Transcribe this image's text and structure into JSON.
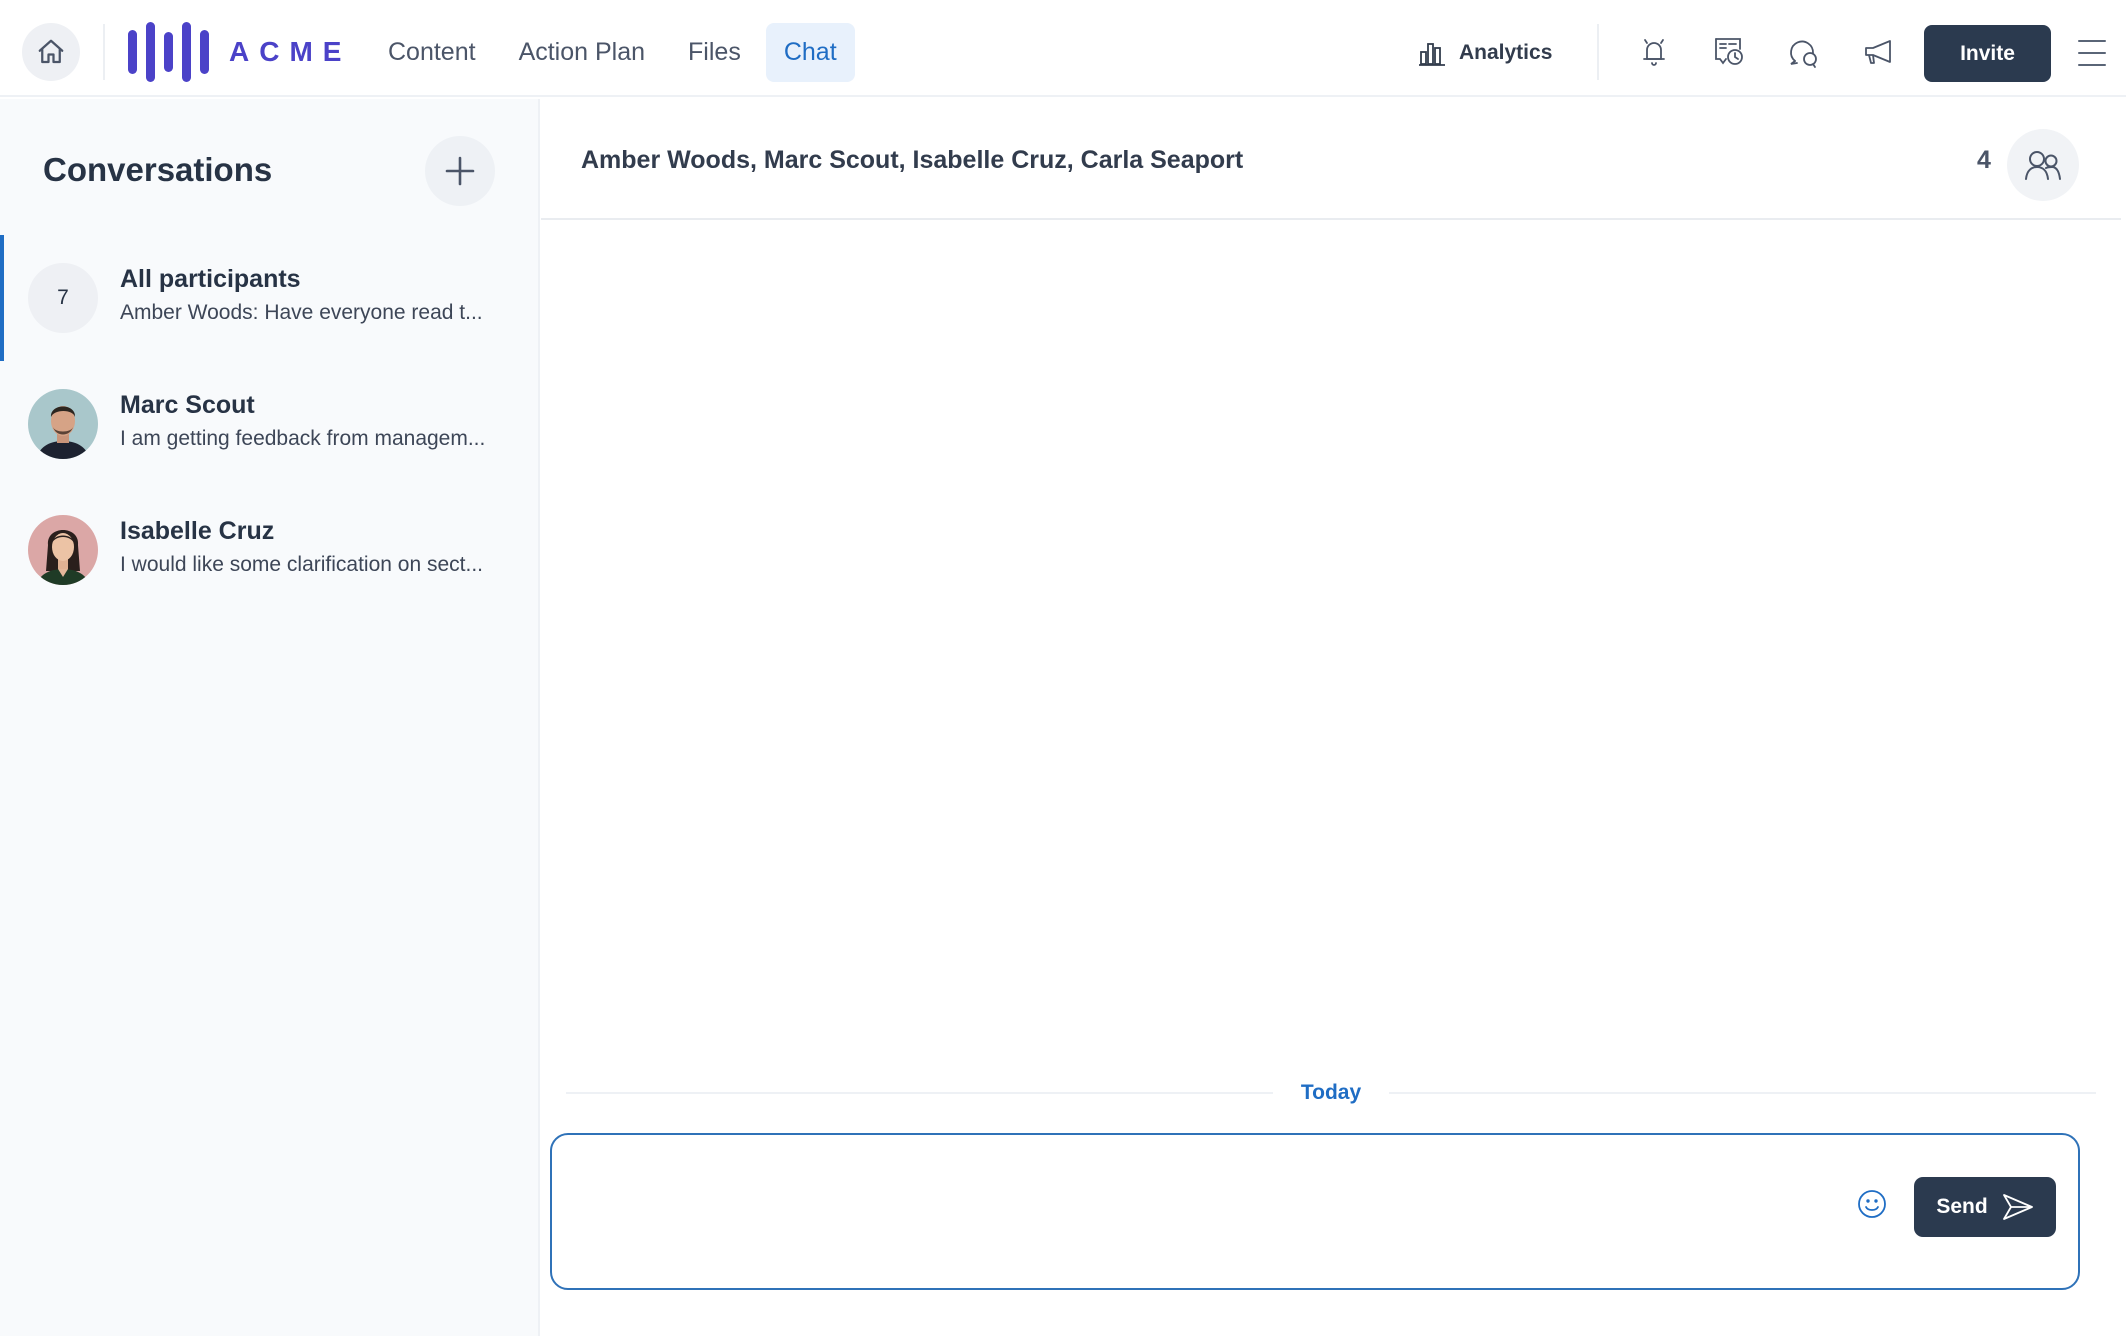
{
  "app": {
    "brand": "ACME",
    "brand_color": "#4b42c8",
    "accent_color": "#1f6dc4"
  },
  "topbar": {
    "home_icon": "home-icon",
    "nav": [
      {
        "label": "Content",
        "active": false
      },
      {
        "label": "Action Plan",
        "active": false
      },
      {
        "label": "Files",
        "active": false
      },
      {
        "label": "Chat",
        "active": true
      }
    ],
    "analytics_label": "Analytics",
    "analytics_icon": "bar-chart-icon",
    "icons": [
      "bell-icon",
      "calendar-clock-icon",
      "chat-search-icon",
      "megaphone-icon"
    ],
    "invite_label": "Invite",
    "menu_icon": "hamburger-menu-icon"
  },
  "sidebar": {
    "title": "Conversations",
    "new_button_icon": "plus-icon",
    "conversations": [
      {
        "name": "All participants",
        "preview": "Amber Woods: Have everyone read t...",
        "count": "7",
        "active": true
      },
      {
        "name": "Marc Scout",
        "preview": "I am getting feedback from managem...",
        "active": false
      },
      {
        "name": "Isabelle Cruz",
        "preview": "I would like some clarification on sect...",
        "active": false
      }
    ]
  },
  "chat": {
    "title": "Amber Woods, Marc Scout, Isabelle Cruz, Carla Seaport",
    "participant_count": "4",
    "participants_icon": "users-icon",
    "day_separator": "Today",
    "composer": {
      "value": "",
      "placeholder": "",
      "emoji_icon": "smiley-icon",
      "send_label": "Send",
      "send_icon": "paper-plane-icon"
    }
  }
}
